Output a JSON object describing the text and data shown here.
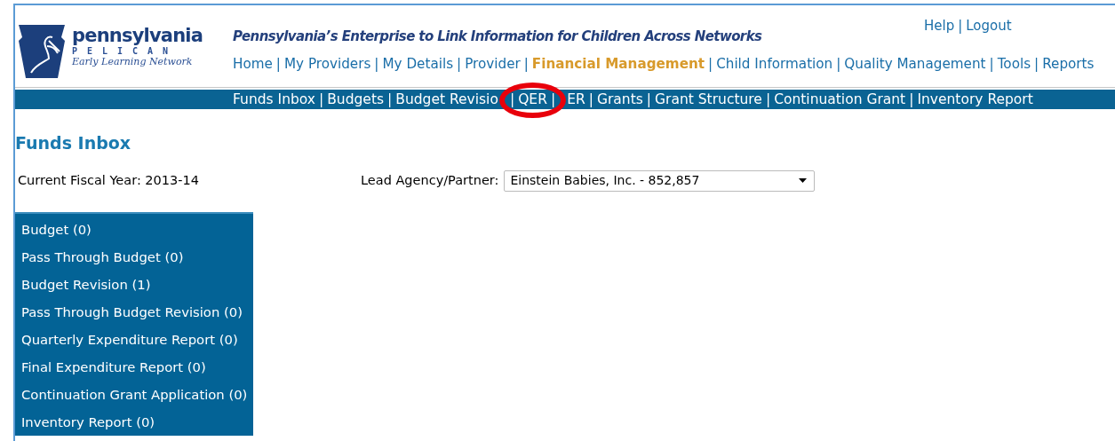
{
  "logo": {
    "name": "pennsylvania",
    "sub": "PELICAN",
    "tagline": "Early Learning Network"
  },
  "site_title": "Pennsylvania’s Enterprise to Link Information for Children Across Networks",
  "separator": "|",
  "utility_links": [
    "Help",
    "Logout"
  ],
  "main_nav": [
    {
      "label": "Home",
      "selected": false
    },
    {
      "label": "My Providers",
      "selected": false
    },
    {
      "label": "My Details",
      "selected": false
    },
    {
      "label": "Provider",
      "selected": false
    },
    {
      "label": "Financial Management",
      "selected": true
    },
    {
      "label": "Child Information",
      "selected": false
    },
    {
      "label": "Quality Management",
      "selected": false
    },
    {
      "label": "Tools",
      "selected": false
    },
    {
      "label": "Reports",
      "selected": false
    }
  ],
  "sub_nav": [
    "Funds Inbox",
    "Budgets",
    "Budget Revisio",
    "QER",
    "ER",
    "Grants",
    "Grant Structure",
    "Continuation Grant",
    "Inventory Report"
  ],
  "page_title": "Funds Inbox",
  "fiscal_year": "Current Fiscal Year: 2013-14",
  "lead_agency": {
    "label": "Lead Agency/Partner:",
    "value": "Einstein Babies, Inc. - 852,857"
  },
  "inbox_items": [
    "Budget (0)",
    "Pass Through Budget (0)",
    "Budget Revision (1)",
    "Pass Through Budget Revision (0)",
    "Quarterly Expenditure Report (0)",
    "Final Expenditure Report (0)",
    "Continuation Grant Application (0)",
    "Inventory Report (0)"
  ]
}
